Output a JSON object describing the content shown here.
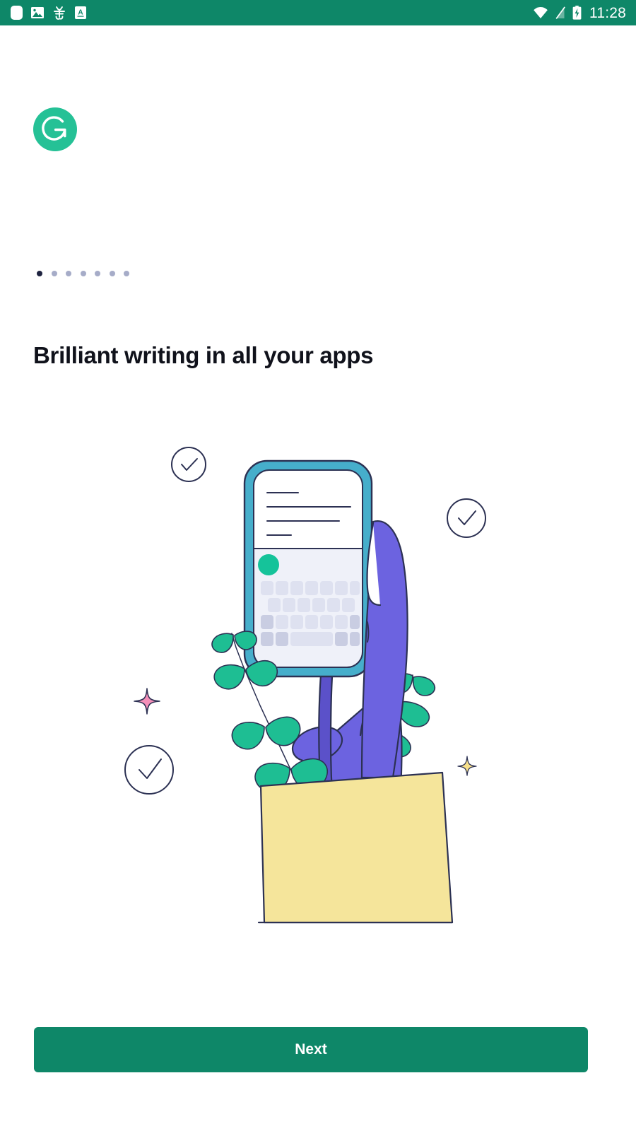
{
  "app": {
    "name": "Grammarly",
    "brand_color": "#0E8768"
  },
  "status_bar": {
    "background": "#0E8768",
    "clock": "11:28",
    "left_icons": [
      {
        "name": "notification-blank-icon",
        "glyph": "rounded-square"
      },
      {
        "name": "photo-icon",
        "glyph": "image"
      },
      {
        "name": "bug-icon",
        "glyph": "bug"
      },
      {
        "name": "text-capture-icon",
        "glyph": "a-box"
      }
    ],
    "right_icons": [
      {
        "name": "wifi-icon",
        "glyph": "wifi"
      },
      {
        "name": "cellular-signal-off-icon",
        "glyph": "signal-slash"
      },
      {
        "name": "battery-charging-icon",
        "glyph": "battery-bolt"
      }
    ]
  },
  "logo": {
    "name": "grammarly-logo",
    "letter": "G",
    "circle_color": "#25C196",
    "mark_color": "#ffffff"
  },
  "pager": {
    "total": 7,
    "active_index": 0,
    "active_color": "#1E2340",
    "inactive_color": "#A6ACC8"
  },
  "onboarding": {
    "title": "Brilliant writing in all your apps",
    "illustration_name": "hand-holding-phone-with-keyboard-illustration"
  },
  "illustration": {
    "colors": {
      "purple_hand": "#6C63E0",
      "purple_shadow": "#5B51C9",
      "teal_phone_frame": "#46AECB",
      "teal_phone_frame_dark": "#3796B4",
      "screen_white": "#FFFFFF",
      "keyboard_bg": "#EFF1F9",
      "key_light": "#DEE1F0",
      "key_dark": "#C9CDE2",
      "grammarly_dot": "#15C39A",
      "leaf_green": "#1EBE93",
      "sleeve_yellow": "#F5E59B",
      "outline": "#2C3153",
      "sparkle_pink": "#F48FB8",
      "sparkle_yellow": "#F7E08A"
    },
    "elements": [
      "checkmark-circle-top-left",
      "checkmark-circle-top-right",
      "checkmark-circle-bottom-left",
      "sparkle-pink",
      "sparkle-yellow",
      "plant-left",
      "plant-right",
      "phone",
      "hand",
      "sleeve",
      "ground-line"
    ]
  },
  "footer": {
    "next_label": "Next",
    "next_color": "#0E8768"
  }
}
